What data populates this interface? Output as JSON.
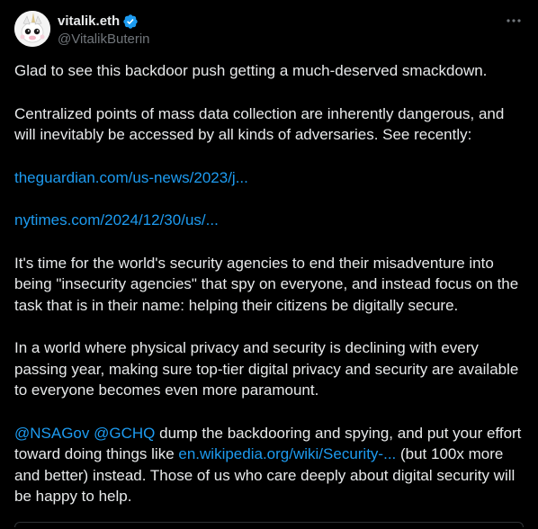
{
  "author": {
    "display_name": "vitalik.eth",
    "handle": "@VitalikButerin",
    "verified_badge_color": "#1d9bf0",
    "avatar_icon": "unicorn-avatar"
  },
  "more_icon": "more-options-icon",
  "tweet": {
    "p1": "Glad to see this backdoor push getting a much-deserved smackdown.",
    "p2": "Centralized points of mass data collection are inherently dangerous, and will inevitably be accessed by all kinds of adversaries. See recently:",
    "link1": "theguardian.com/us-news/2023/j...",
    "link2": "nytimes.com/2024/12/30/us/...",
    "p3": "It's time for the world's security agencies to end their misadventure into being \"insecurity agencies\" that spy on everyone, and instead focus on the task that is in their name: helping their citizens be digitally secure.",
    "p4": "In a world where physical privacy and security is declining with every passing year, making sure top-tier digital privacy and security are available to everyone becomes even more paramount.",
    "p5": {
      "mention1": "@NSAGov",
      "mention2": "@GCHQ",
      "text_a": " dump the backdooring and spying, and put your effort toward doing things like ",
      "link": "en.wikipedia.org/wiki/Security-...",
      "text_b": " (but 100x more and better) instead. Those of us who care deeply about digital security will be happy to help."
    }
  },
  "colors": {
    "background": "#000000",
    "text": "#e7e9ea",
    "secondary_text": "#71767b",
    "link": "#1d9bf0"
  }
}
